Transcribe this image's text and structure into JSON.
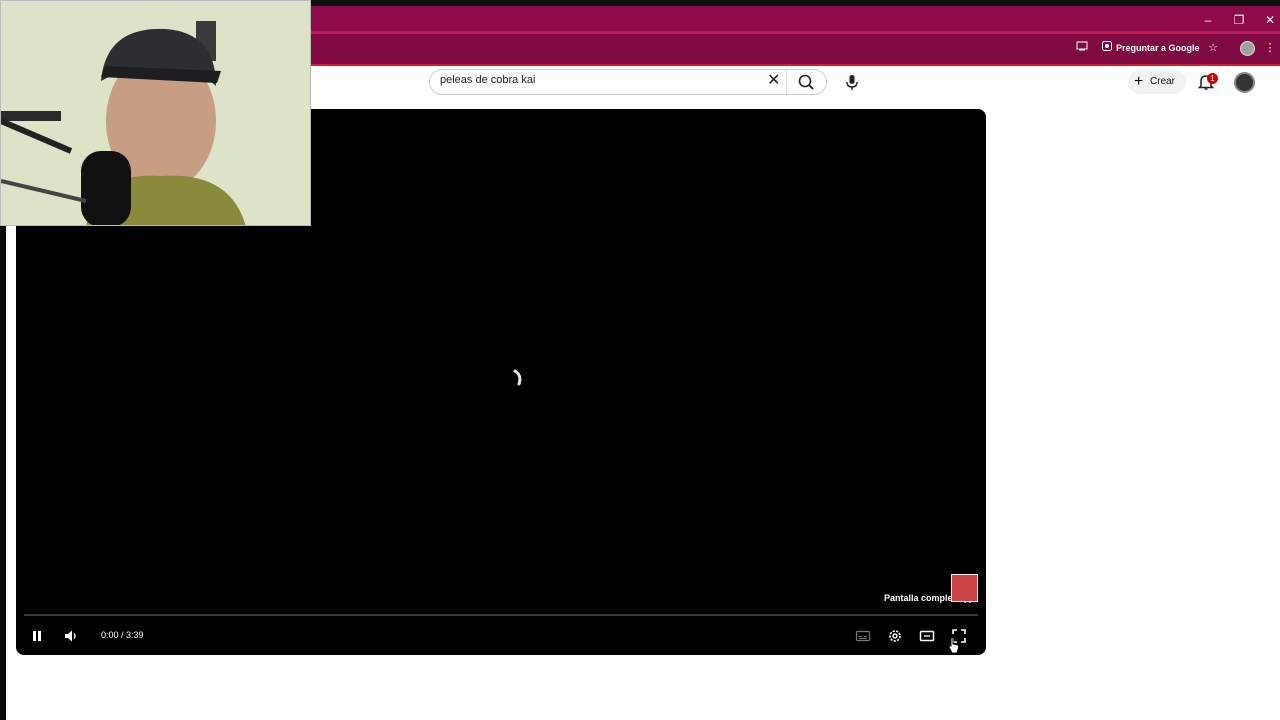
{
  "browser": {
    "ask_google_label": "Preguntar a Google",
    "window_controls": [
      "–",
      "❐",
      "✕"
    ]
  },
  "header": {
    "search_value": "peleas de cobra kai",
    "create_label": "Crear",
    "notification_count": "1"
  },
  "player": {
    "time_display": "0:00 / 3:39",
    "fullscreen_tooltip": "Pantalla completa (f)",
    "progress_fraction": 0.0
  },
  "colors": {
    "browser_frame": "#8c0b48",
    "toolbar": "#7e0a41",
    "player_bg": "#000000"
  },
  "icons": {
    "search": "search-icon",
    "clear": "close-icon",
    "mic": "mic-icon",
    "bell": "bell-icon",
    "pause": "pause-icon",
    "volume": "volume-icon",
    "subtitles": "subtitles-icon",
    "settings": "gear-icon",
    "theater": "theater-mode-icon",
    "fullscreen": "fullscreen-icon"
  }
}
